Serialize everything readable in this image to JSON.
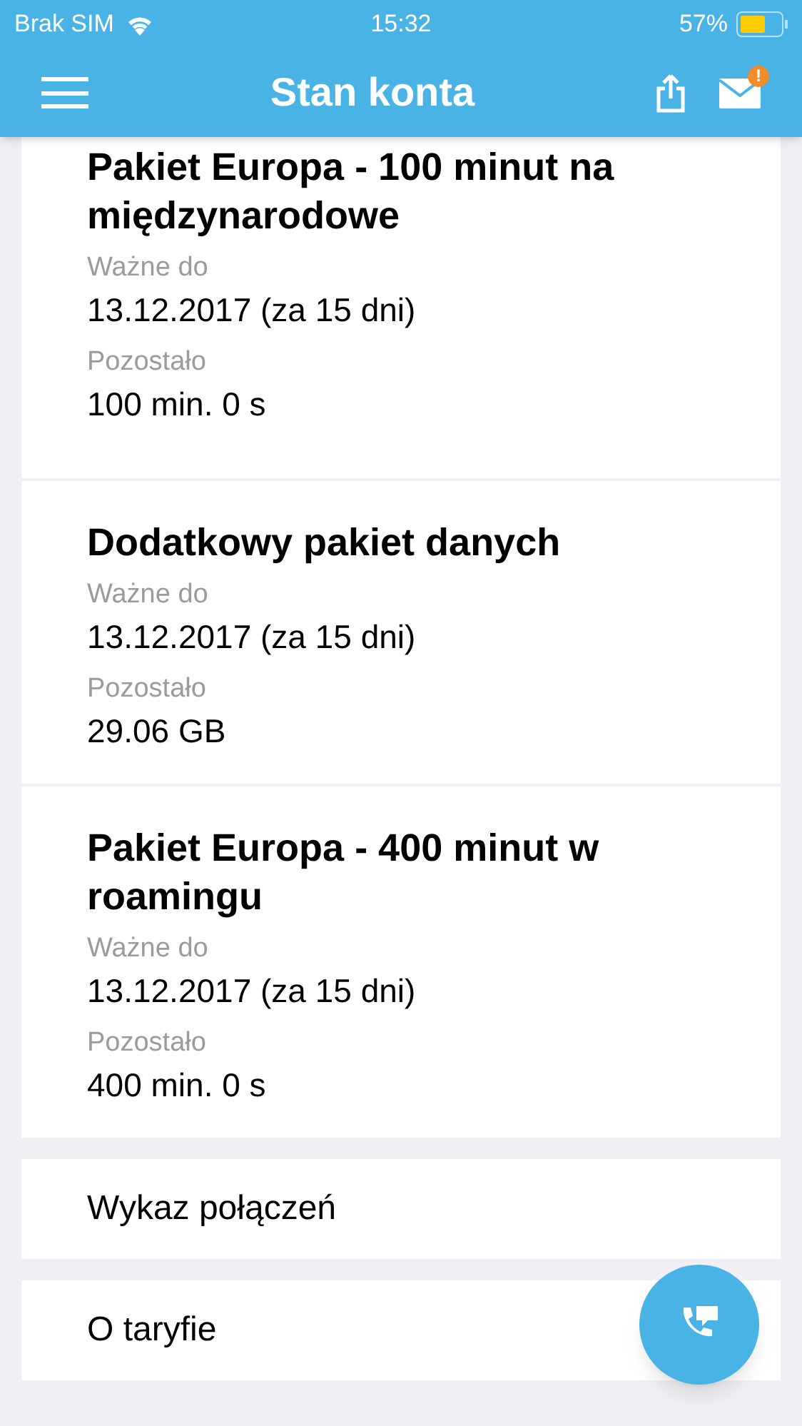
{
  "status_bar": {
    "carrier": "Brak SIM",
    "time": "15:32",
    "battery": "57%"
  },
  "nav": {
    "title": "Stan konta",
    "mail_badge": "!"
  },
  "packages": [
    {
      "title": "Pakiet Europa - 100 minut na międzynarodowe",
      "valid_label": "Ważne do",
      "valid_value": "13.12.2017 (za 15 dni)",
      "remaining_label": "Pozostało",
      "remaining_value": "100 min. 0 s"
    },
    {
      "title": "Dodatkowy pakiet danych",
      "valid_label": "Ważne do",
      "valid_value": "13.12.2017 (za 15 dni)",
      "remaining_label": "Pozostało",
      "remaining_value": "29.06 GB"
    },
    {
      "title": "Pakiet Europa - 400 minut w roamingu",
      "valid_label": "Ważne do",
      "valid_value": "13.12.2017 (za 15 dni)",
      "remaining_label": "Pozostało",
      "remaining_value": "400 min. 0 s"
    }
  ],
  "links": [
    "Wykaz połączeń",
    "O taryfie"
  ]
}
